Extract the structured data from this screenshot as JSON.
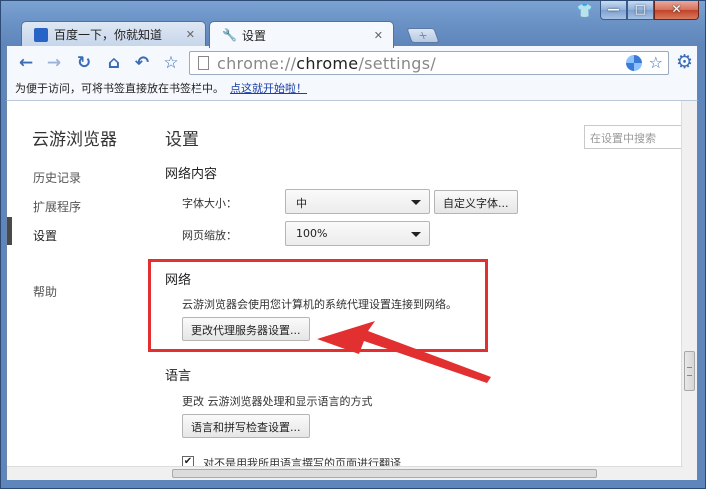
{
  "window": {
    "pin_icon": "shirt-icon",
    "minimize_glyph": "—",
    "maximize_glyph": "□",
    "close_glyph": "✕"
  },
  "tabs": [
    {
      "label": "百度一下，你就知道",
      "icon": "paw-icon",
      "active": false
    },
    {
      "label": "设置",
      "icon": "wrench-icon",
      "active": true
    }
  ],
  "toolbar": {
    "url_scheme": "chrome://",
    "url_host": "chrome",
    "url_path": "/settings/",
    "accent": "#3a6db5"
  },
  "bookmark_bar": {
    "message": "为便于访问，可将书签直接放在书签栏中。",
    "link": "点这就开始啦！"
  },
  "sidebar": {
    "brand": "云游浏览器",
    "items": [
      {
        "label": "历史记录"
      },
      {
        "label": "扩展程序"
      },
      {
        "label": "设置",
        "selected": true
      },
      {
        "label": "帮助"
      }
    ]
  },
  "main": {
    "title": "设置",
    "search_placeholder": "在设置中搜索",
    "web_content": {
      "title": "网络内容",
      "font_size_label": "字体大小：",
      "font_size_value": "中",
      "custom_font_button": "自定义字体...",
      "zoom_label": "网页缩放：",
      "zoom_value": "100%"
    },
    "network": {
      "title": "网络",
      "description": "云游浏览器会使用您计算机的系统代理设置连接到网络。",
      "proxy_button": "更改代理服务器设置..."
    },
    "language": {
      "title": "语言",
      "description": "更改 云游浏览器处理和显示语言的方式",
      "spellcheck_button": "语言和拼写检查设置...",
      "translate_checkbox": "对不是用我所用语言撰写的页面进行翻译",
      "translate_checked": true
    }
  },
  "annotation_color": "#e23030"
}
